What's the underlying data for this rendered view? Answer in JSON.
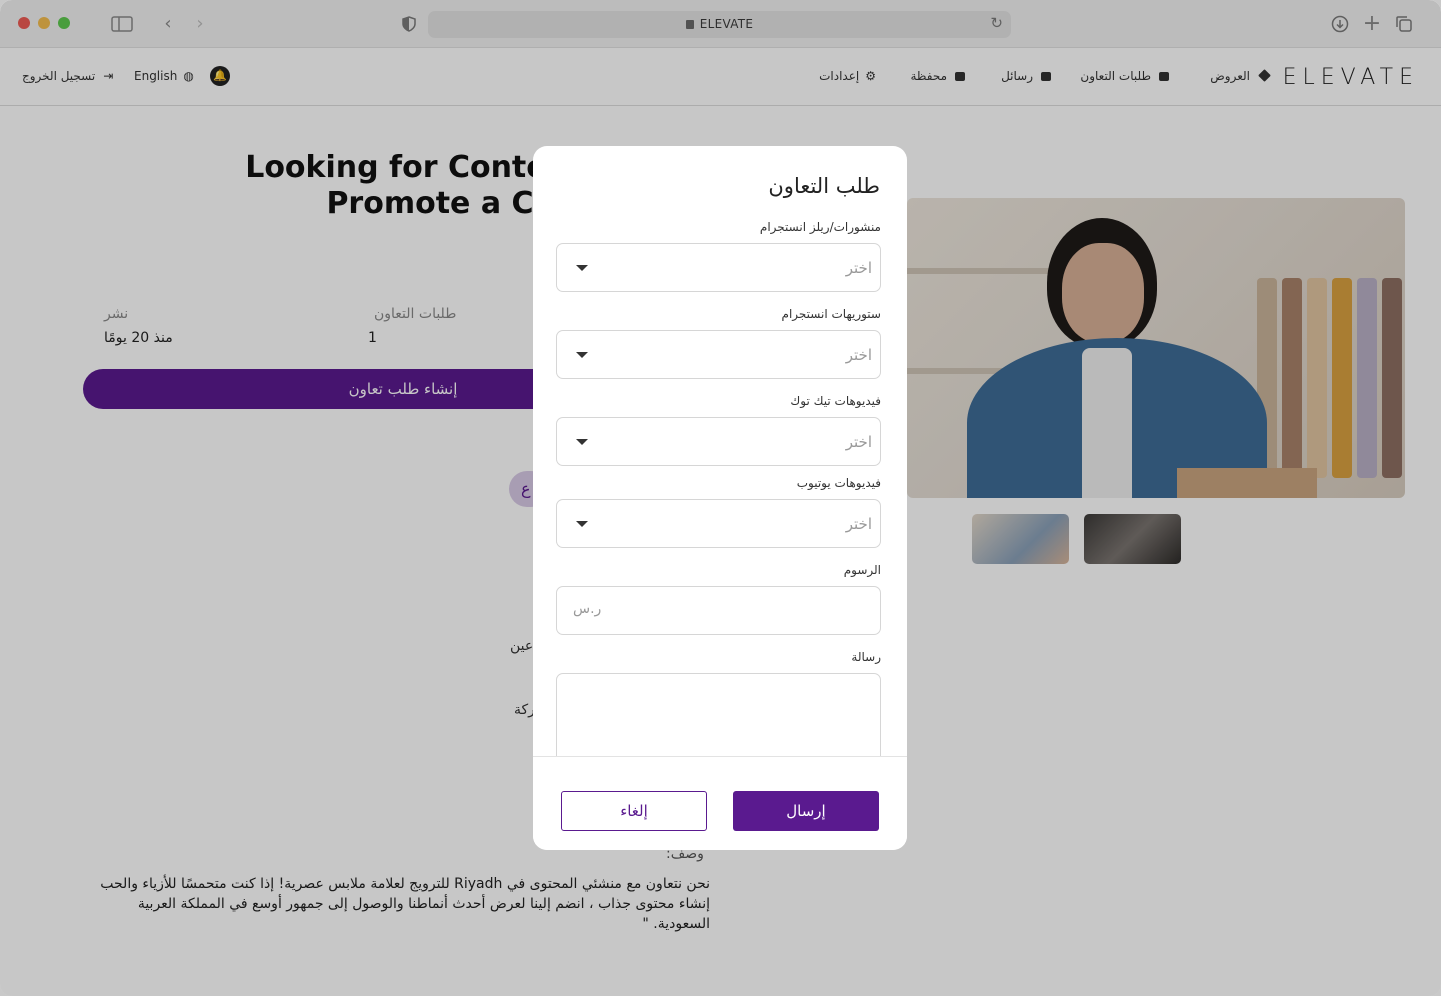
{
  "browser": {
    "url": "ELEVATE"
  },
  "header": {
    "logo": "ELEVATE",
    "nav": {
      "offers": "العروض",
      "collab_requests": "طلبات التعاون",
      "messages": "رسائل",
      "wallet": "محفظة",
      "settings": "إعدادات"
    },
    "language": "English",
    "logout": "تسجيل الخروج"
  },
  "page": {
    "title_line1": "Looking for Content C",
    "title_line2": "Promote a C",
    "stats": {
      "published_label": "نشر",
      "published_value": "منذ 20 يومًا",
      "requests_label": "طلبات التعاون",
      "requests_value": "1"
    },
    "create_button": "إنشاء طلب تعاون",
    "chip_text": "ع",
    "fragment1": "عين",
    "fragment2": "ركة",
    "description_label": "وصف:",
    "description": "نحن نتعاون مع منشئي المحتوى في Riyadh للترويج لعلامة ملابس عصرية! إذا كنت متحمسًا للأزياء والحب إنشاء محتوى جذاب ، انضم إلينا لعرض أحدث أنماطنا والوصول إلى جمهور أوسع في المملكة العربية السعودية. \""
  },
  "modal": {
    "title": "طلب التعاون",
    "fields": {
      "ig_posts_label": "منشورات/ريلز انستجرام",
      "ig_stories_label": "ستوريهات انستجرام",
      "tiktok_label": "فيديوهات تيك توك",
      "youtube_label": "فيديوهات يوتيوب",
      "select_placeholder": "اختر",
      "fees_label": "الرسوم",
      "fees_placeholder": "ر.س",
      "message_label": "رسالة"
    },
    "cancel": "إلغاء",
    "send": "إرسال"
  },
  "colors": {
    "brand": "#5a1a8f",
    "overlay": "rgba(0,0,0,0.22)"
  }
}
